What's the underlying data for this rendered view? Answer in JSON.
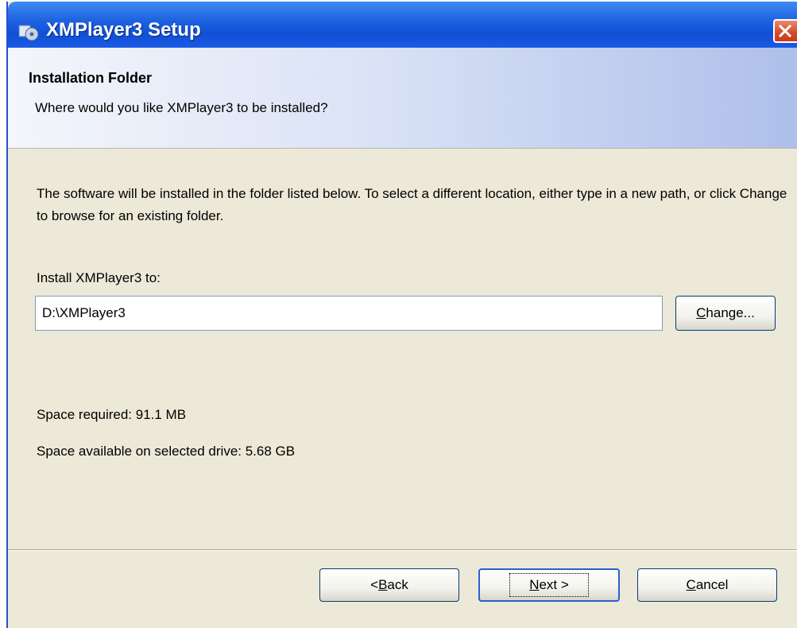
{
  "window": {
    "title": "XMPlayer3 Setup",
    "icon": "setup-app-icon",
    "close_icon": "close-icon"
  },
  "header": {
    "title": "Installation Folder",
    "subtitle": "Where would you like XMPlayer3 to be installed?"
  },
  "body": {
    "description": "The software will be installed in the folder listed below. To select a different location, either type in a new path, or click Change to browse for an existing folder.",
    "install_label": "Install XMPlayer3 to:",
    "install_path": "D:\\XMPlayer3",
    "change_button": {
      "underlined": "C",
      "rest": "hange..."
    },
    "space_required": "Space required: 91.1 MB",
    "space_available": "Space available on selected drive: 5.68 GB"
  },
  "footer": {
    "back_button": {
      "prefix": "< ",
      "underlined": "B",
      "rest": "ack"
    },
    "next_button": {
      "underlined": "N",
      "rest": "ext >"
    },
    "cancel_button": {
      "underlined": "C",
      "rest": "ancel"
    }
  }
}
